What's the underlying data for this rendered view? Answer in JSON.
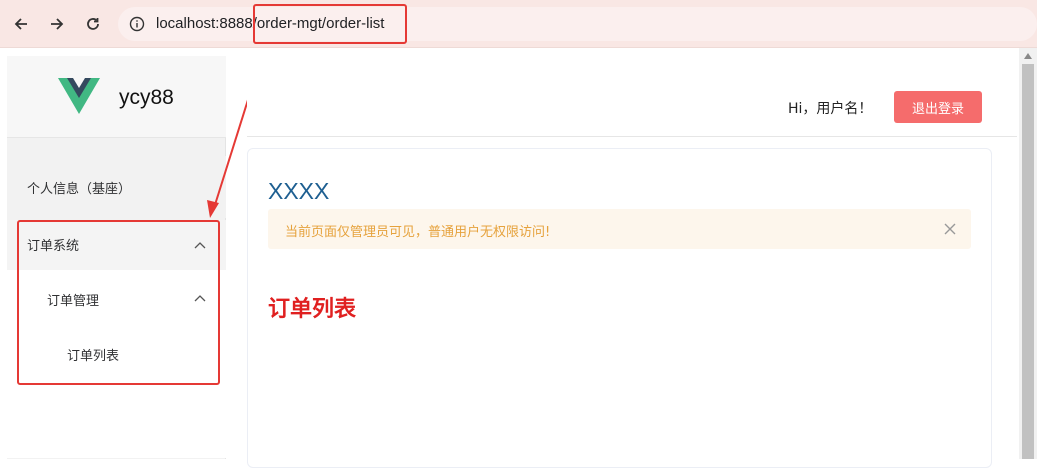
{
  "browser": {
    "back_icon": "arrow-left-icon",
    "forward_icon": "arrow-right-icon",
    "reload_icon": "reload-icon",
    "url_host": "localhost:8888",
    "url_path": "/order-mgt/order-list"
  },
  "sidebar": {
    "logo_text": "ycy88",
    "items": [
      {
        "label": "个人信息（基座）"
      },
      {
        "label": "订单系统",
        "expanded": true
      },
      {
        "label": "订单管理",
        "expanded": true
      },
      {
        "label": "订单列表"
      }
    ]
  },
  "header": {
    "greeting": "Hi，用户名！",
    "logout_label": "退出登录"
  },
  "main": {
    "title": "XXXX",
    "alert_text": "当前页面仅管理员可见，普通用户无权限访问!",
    "heading": "订单列表"
  },
  "colors": {
    "accent_red": "#e53935",
    "logout_bg": "#f56c6c",
    "title_blue": "#1e5f91",
    "alert_bg": "#fdf6ec",
    "alert_text": "#e6a23c"
  }
}
